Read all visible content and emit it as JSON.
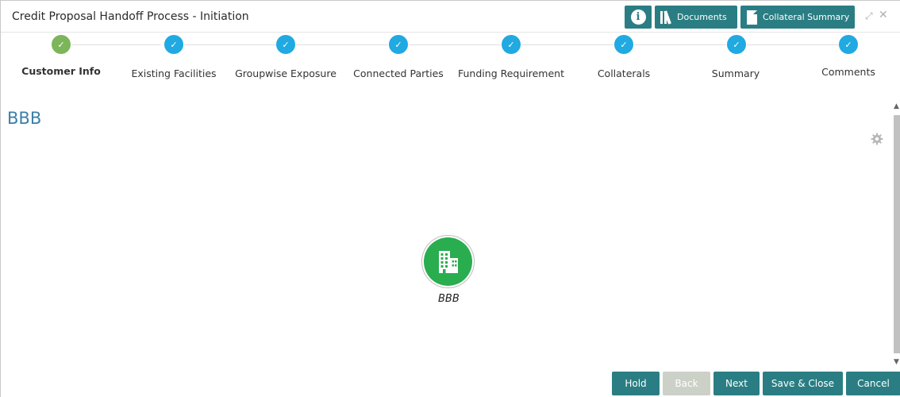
{
  "window": {
    "title": "Credit Proposal Handoff Process - Initiation"
  },
  "header_buttons": {
    "info": "i",
    "documents": "Documents",
    "collateral_summary": "Collateral Summary"
  },
  "window_controls": {
    "expand": "⤢",
    "close": "✕"
  },
  "steps": [
    {
      "label": "Customer Info",
      "state": "active-complete"
    },
    {
      "label": "Existing Facilities",
      "state": "complete"
    },
    {
      "label": "Groupwise Exposure",
      "state": "complete"
    },
    {
      "label": "Connected Parties",
      "state": "complete"
    },
    {
      "label": "Funding Requirement",
      "state": "complete"
    },
    {
      "label": "Collaterals",
      "state": "complete"
    },
    {
      "label": "Summary",
      "state": "complete"
    },
    {
      "label": "Comments",
      "state": "complete"
    }
  ],
  "step_check": "✓",
  "content": {
    "title": "BBB",
    "node_label": "BBB"
  },
  "icons": {
    "settings": "gear-icon",
    "node": "building-icon"
  },
  "colors": {
    "teal": "#2a7e83",
    "step_blue": "#21a9e1",
    "step_green": "#7cb55a",
    "node_green": "#29ad4f",
    "title_blue": "#3d7fa8"
  },
  "footer": {
    "hold": "Hold",
    "back": "Back",
    "next": "Next",
    "save_close": "Save & Close",
    "cancel": "Cancel"
  }
}
